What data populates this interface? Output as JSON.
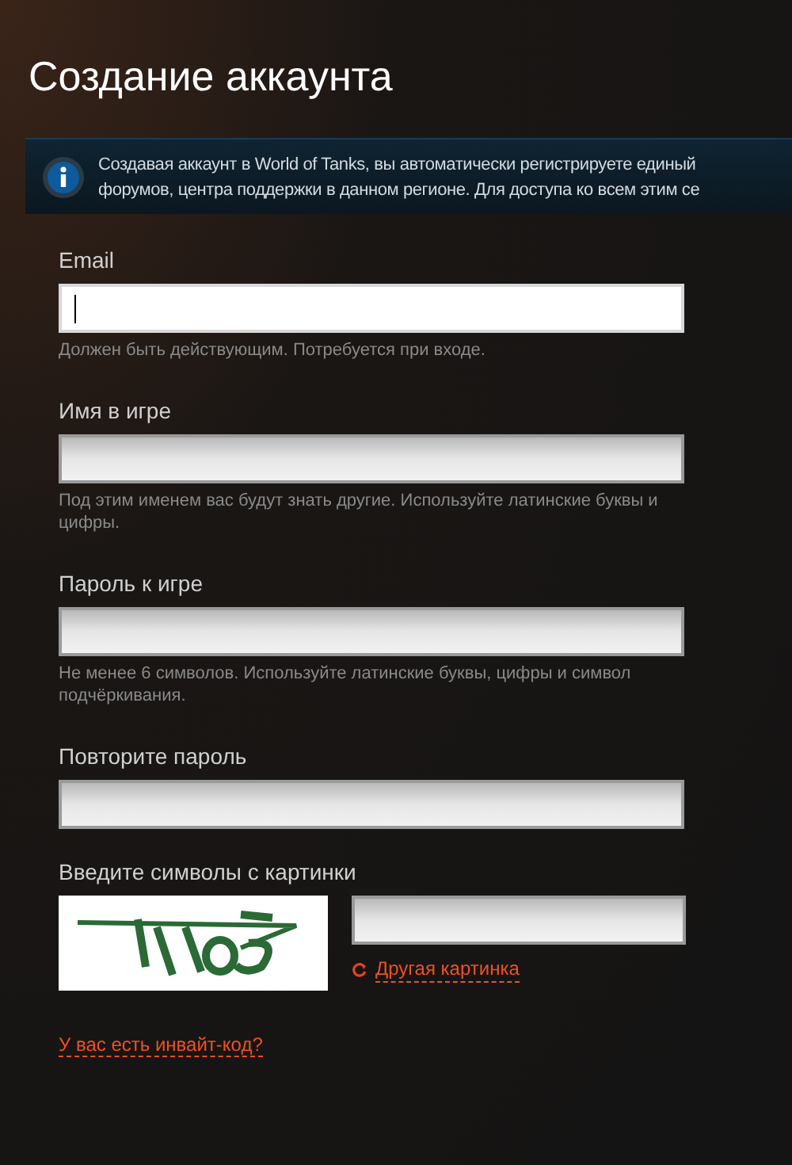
{
  "title": "Создание аккаунта",
  "info": {
    "lines": [
      "Создавая аккаунт в World of Tanks, вы автоматически регистрируете единый",
      "форумов, центра поддержки в данном регионе. Для доступа ко всем этим се"
    ]
  },
  "fields": [
    {
      "label": "Email",
      "focused": true,
      "hint": "Должен быть действующим. Потребуется при входе."
    },
    {
      "label": "Имя в игре",
      "focused": false,
      "hint": "Под этим именем вас будут знать другие. Используйте латинские буквы и цифры."
    },
    {
      "label": "Пароль к игре",
      "focused": false,
      "hint": "Не менее 6 символов. Используйте латинские буквы, цифры и символ подчёркивания."
    },
    {
      "label": "Повторите пароль",
      "focused": false
    }
  ],
  "captcha": {
    "label": "Введите символы с картинки",
    "refresh_link": "Другая картинка"
  },
  "invite_link": "У вас есть инвайт-код?"
}
